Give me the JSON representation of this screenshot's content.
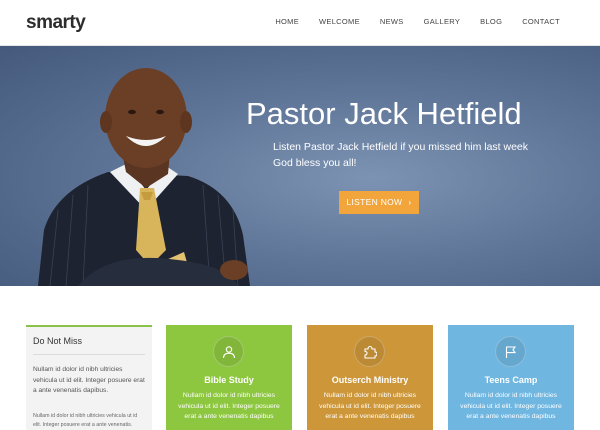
{
  "header": {
    "logo": "smarty",
    "nav": [
      "HOME",
      "WELCOME",
      "NEWS",
      "GALLERY",
      "BLOG",
      "CONTACT"
    ]
  },
  "hero": {
    "title": "Pastor Jack Hetfield",
    "subtitle": "Listen Pastor Jack Hetfield if you missed him last week God bless you all!",
    "button": "LISTEN NOW",
    "button_icon": "chevron-right-icon"
  },
  "sidebar_card": {
    "title": "Do Not Miss",
    "text1": "Nullam id dolor id nibh ultricies vehicula ut id elit. Integer posuere erat a ante venenatis dapibus.",
    "text2": "Nullam id dolor id nibh ultricies vehicula ut id elit. Integer posuere erat a ante venenatis."
  },
  "cards": [
    {
      "title": "Bible Study",
      "text": "Nullam id dolor id nibh ultricies vehicula ut id elit. Integer posuere erat a ante venenatis dapibus",
      "icon": "user-icon",
      "color": "#8dc63f"
    },
    {
      "title": "Outserch Ministry",
      "text": "Nullam id dolor id nibh ultricies vehicula ut id elit. Integer posuere erat a ante venenatis dapibus",
      "icon": "puzzle-icon",
      "color": "#cc9639"
    },
    {
      "title": "Teens Camp",
      "text": "Nullam id dolor id nibh ultricies vehicula ut id elit. Integer posuere erat a ante venenatis dapibus",
      "icon": "flag-icon",
      "color": "#6fb6e0"
    }
  ],
  "colors": {
    "accent_button": "#f1a53b",
    "hero_background": "#5f7698",
    "sidebar_accent": "#8bc34a"
  }
}
